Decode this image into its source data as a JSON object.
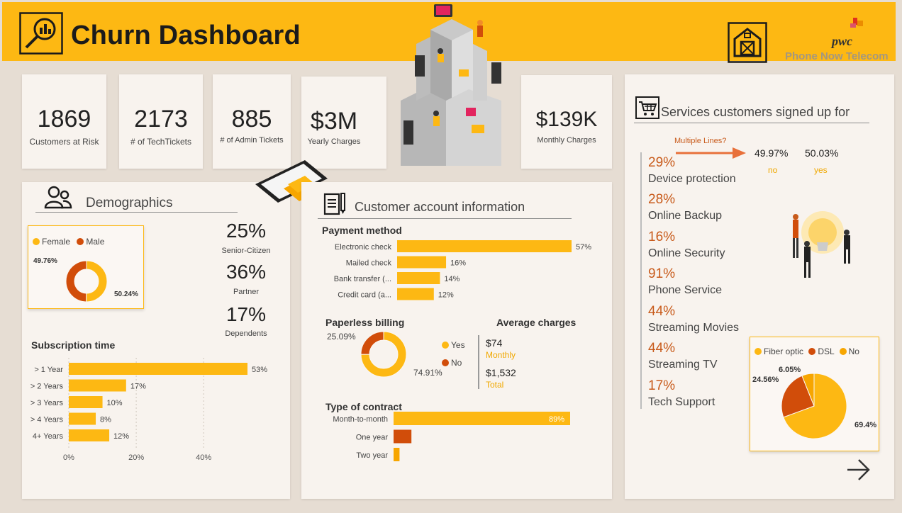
{
  "header": {
    "title": "Churn Dashboard",
    "company": "Phone Now Telecom",
    "logo_text": "pwc"
  },
  "colors": {
    "accent": "#fdb813",
    "orange": "#f7a600",
    "dark_orange": "#d14d0a",
    "text_orange": "#c85a1a"
  },
  "kpis": [
    {
      "value": "1869",
      "label": "Customers at Risk"
    },
    {
      "value": "2173",
      "label": "# of TechTickets"
    },
    {
      "value": "885",
      "label": "# of Admin Tickets"
    },
    {
      "value": "$3M",
      "label": "Yearly Charges"
    },
    {
      "value": "$139K",
      "label": "Monthly Charges"
    }
  ],
  "demographics": {
    "title": "Demographics",
    "stats": [
      {
        "value": "25%",
        "label": "Senior-Citizen"
      },
      {
        "value": "36%",
        "label": "Partner"
      },
      {
        "value": "17%",
        "label": "Dependents"
      }
    ],
    "subscription_title": "Subscription time"
  },
  "account": {
    "title": "Customer account information",
    "payment_title": "Payment method",
    "paperless_title": "Paperless billing",
    "avg_title": "Average charges",
    "avg_monthly_value": "$74",
    "avg_monthly_label": "Monthly",
    "avg_total_value": "$1,532",
    "avg_total_label": "Total",
    "contract_title": "Type of contract"
  },
  "services": {
    "title": "Services customers signed up for",
    "multiple_lines_label": "Multiple Lines?",
    "multiple_lines_no_value": "49.97%",
    "multiple_lines_no_label": "no",
    "multiple_lines_yes_value": "50.03%",
    "multiple_lines_yes_label": "yes",
    "items": [
      {
        "pct": "29%",
        "name": "Device protection"
      },
      {
        "pct": "28%",
        "name": "Online Backup"
      },
      {
        "pct": "16%",
        "name": "Online Security"
      },
      {
        "pct": "91%",
        "name": "Phone Service"
      },
      {
        "pct": "44%",
        "name": "Streaming Movies"
      },
      {
        "pct": "44%",
        "name": "Streaming TV"
      },
      {
        "pct": "17%",
        "name": "Tech Support"
      }
    ]
  },
  "chart_data": [
    {
      "type": "pie",
      "subtype": "donut",
      "categories": [
        "Female",
        "Male"
      ],
      "values": [
        50.24,
        49.76
      ],
      "labels": [
        "50.24%",
        "49.76%"
      ],
      "colors": [
        "#fdb813",
        "#d14d0a"
      ],
      "legend": "top"
    },
    {
      "type": "bar",
      "orientation": "horizontal",
      "title": "Subscription time",
      "categories": [
        "> 1 Year",
        "> 2 Years",
        "> 3 Years",
        "> 4 Years",
        "4+ Years"
      ],
      "values": [
        53,
        17,
        10,
        8,
        12
      ],
      "labels": [
        "53%",
        "17%",
        "10%",
        "8%",
        "12%"
      ],
      "xticks": [
        "0%",
        "20%",
        "40%"
      ],
      "xlim": [
        0,
        53
      ],
      "grid": true
    },
    {
      "type": "bar",
      "orientation": "horizontal",
      "title": "Payment method",
      "categories": [
        "Electronic check",
        "Mailed check",
        "Bank transfer (...",
        "Credit card (a..."
      ],
      "values": [
        57,
        16,
        14,
        12
      ],
      "labels": [
        "57%",
        "16%",
        "14%",
        "12%"
      ]
    },
    {
      "type": "pie",
      "subtype": "donut",
      "title": "Paperless billing",
      "categories": [
        "Yes",
        "No"
      ],
      "values": [
        74.91,
        25.09
      ],
      "labels": [
        "74.91%",
        "25.09%"
      ],
      "colors": [
        "#fdb813",
        "#d14d0a"
      ],
      "legend": "right"
    },
    {
      "type": "bar",
      "orientation": "horizontal",
      "title": "Type of contract",
      "categories": [
        "Month-to-month",
        "One year",
        "Two year"
      ],
      "values": [
        89,
        9,
        3
      ],
      "labels": [
        "89%"
      ],
      "colors": [
        "#fdb813",
        "#d14d0a",
        "#f7a600"
      ]
    },
    {
      "type": "pie",
      "categories": [
        "Fiber optic",
        "DSL",
        "No"
      ],
      "values": [
        69.4,
        24.56,
        6.05
      ],
      "labels": [
        "69.4%",
        "24.56%",
        "6.05%"
      ],
      "colors": [
        "#fdb813",
        "#d14d0a",
        "#f7a600"
      ],
      "legend": "top"
    }
  ]
}
